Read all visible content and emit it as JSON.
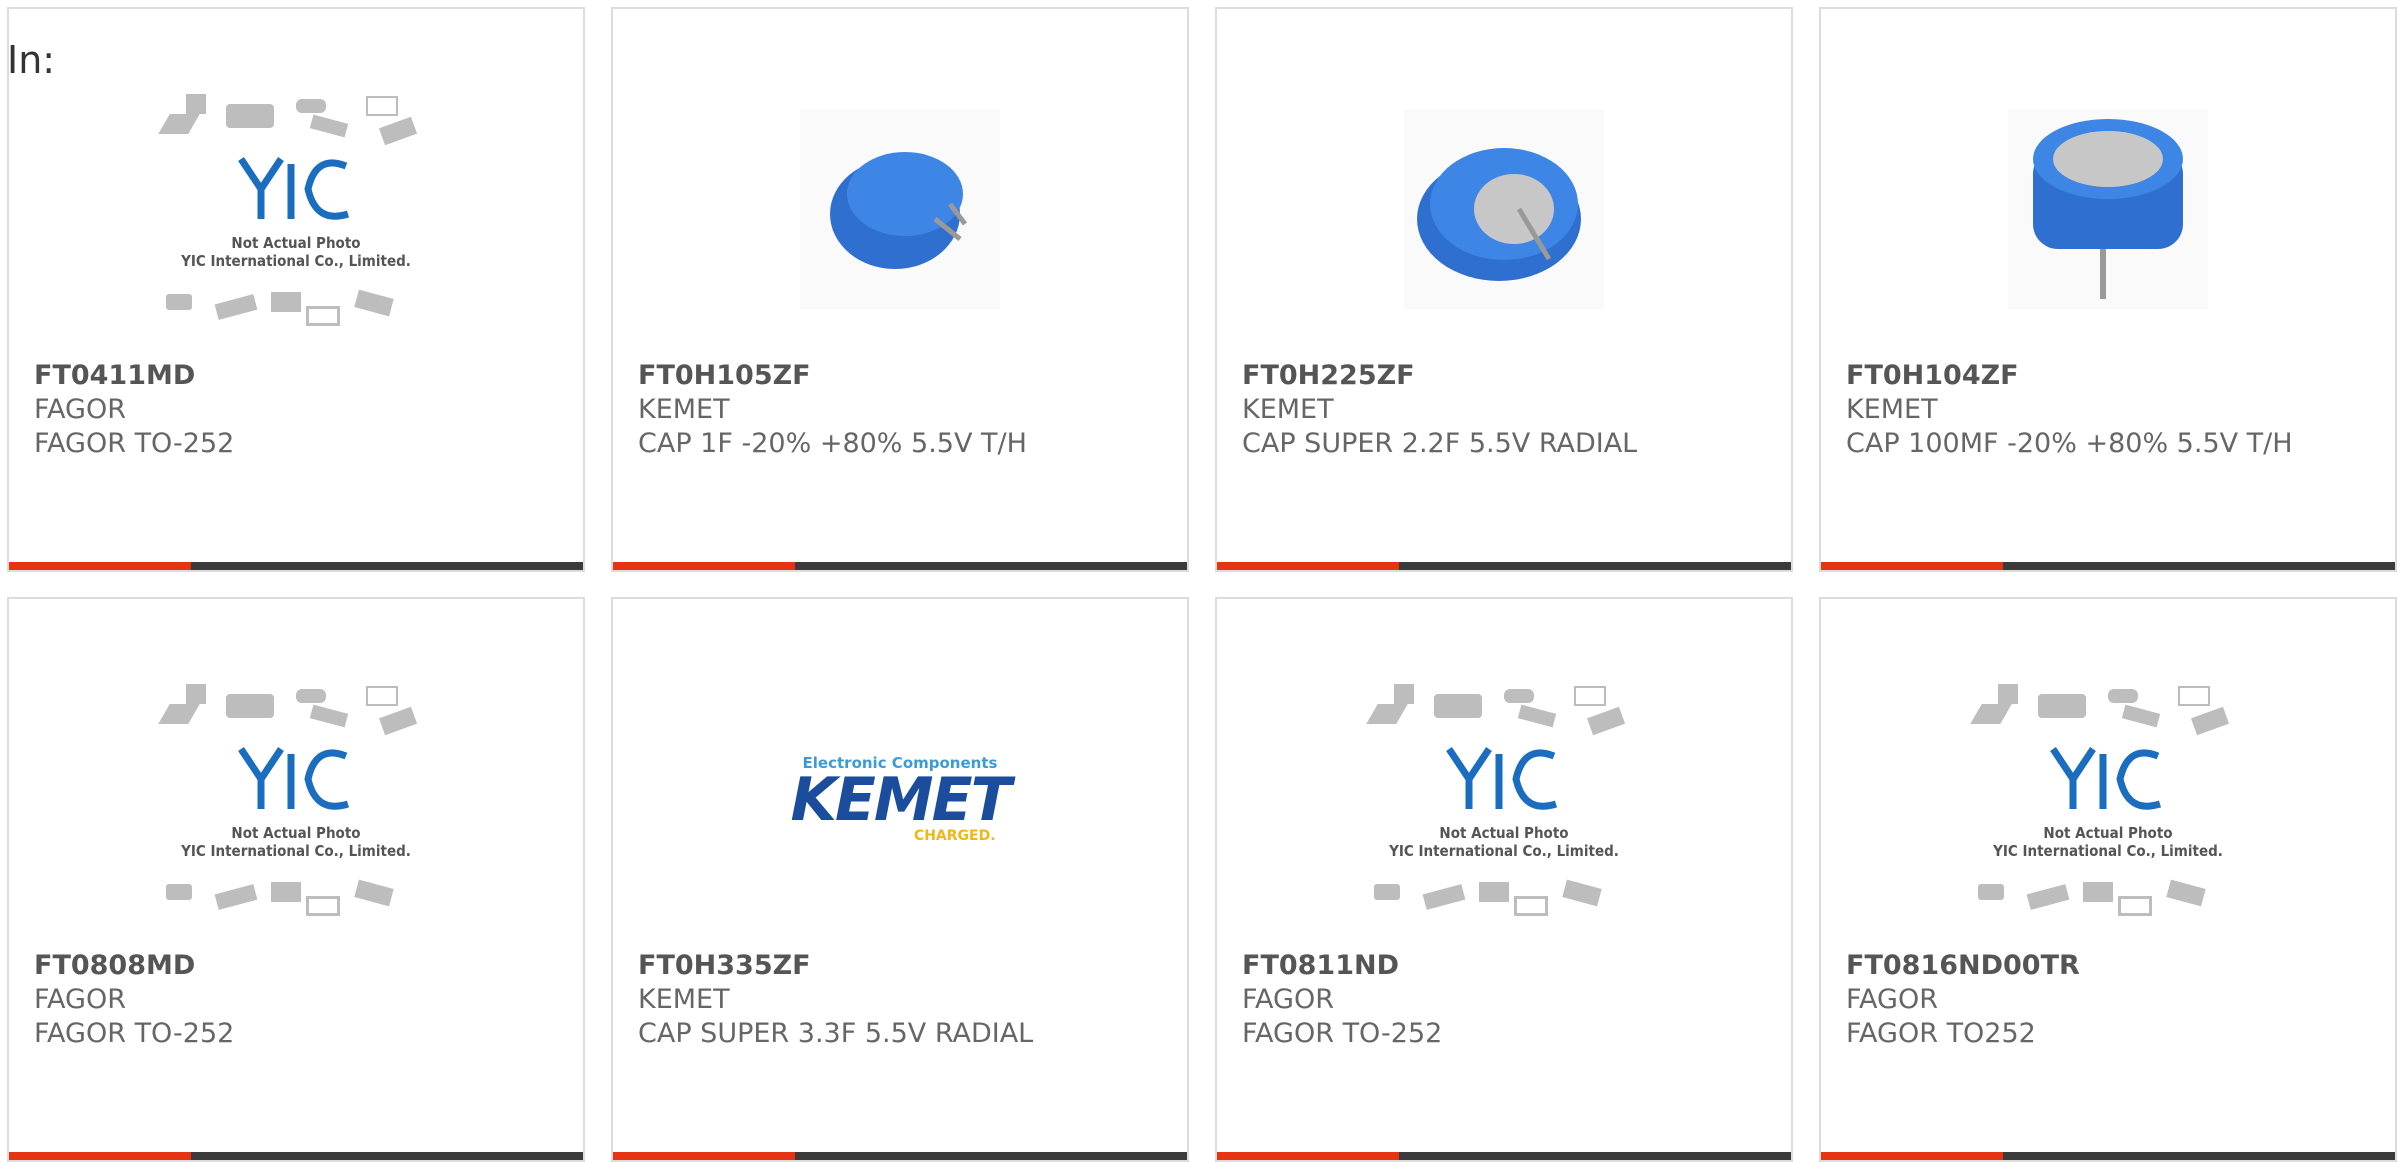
{
  "header": {
    "in_label": "In:"
  },
  "placeholder": {
    "caption_line1": "Not Actual Photo",
    "caption_line2": "YIC International Co., Limited."
  },
  "kemet_logo": {
    "top": "Electronic Components",
    "main": "KEMET",
    "tagline": "CHARGED."
  },
  "colors": {
    "accent": "#e63312",
    "bar": "#3b3b3b",
    "kemet_blue": "#1b4d9c",
    "cap_blue": "#2f6fd0"
  },
  "products": [
    {
      "part": "FT0411MD",
      "maker": "FAGOR",
      "desc": "FAGOR TO-252",
      "image": "yic-placeholder"
    },
    {
      "part": "FT0H105ZF",
      "maker": "KEMET",
      "desc": "CAP 1F -20% +80% 5.5V T/H",
      "image": "supercap-small"
    },
    {
      "part": "FT0H225ZF",
      "maker": "KEMET",
      "desc": "CAP SUPER 2.2F 5.5V RADIAL",
      "image": "supercap-radial"
    },
    {
      "part": "FT0H104ZF",
      "maker": "KEMET",
      "desc": "CAP 100MF -20% +80% 5.5V T/H",
      "image": "supercap-upright"
    },
    {
      "part": "FT0808MD",
      "maker": "FAGOR",
      "desc": "FAGOR TO-252",
      "image": "yic-placeholder"
    },
    {
      "part": "FT0H335ZF",
      "maker": "KEMET",
      "desc": "CAP SUPER 3.3F 5.5V RADIAL",
      "image": "kemet-logo"
    },
    {
      "part": "FT0811ND",
      "maker": "FAGOR",
      "desc": "FAGOR TO-252",
      "image": "yic-placeholder"
    },
    {
      "part": "FT0816ND00TR",
      "maker": "FAGOR",
      "desc": "FAGOR TO252",
      "image": "yic-placeholder"
    }
  ]
}
